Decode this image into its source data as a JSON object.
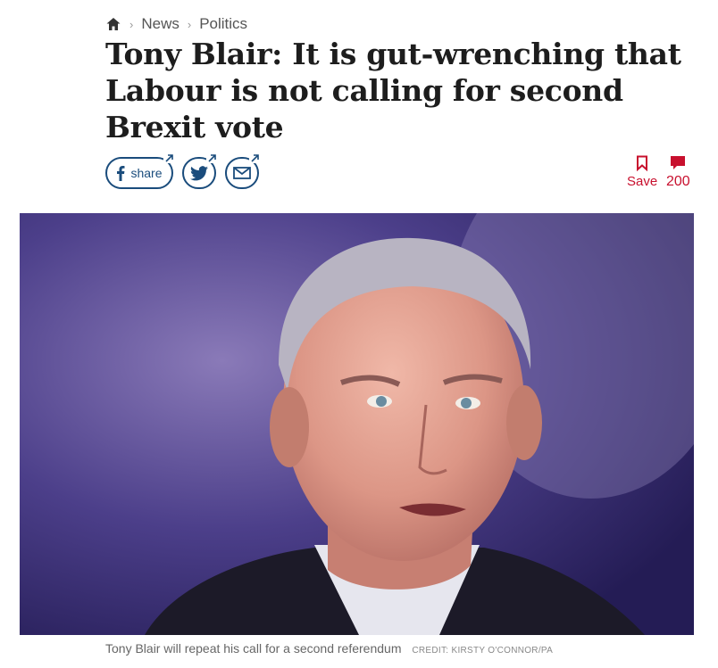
{
  "breadcrumb": {
    "items": [
      "News",
      "Politics"
    ]
  },
  "article": {
    "title": "Tony Blair: It is gut-wrenching that Labour is not calling for second Brexit vote"
  },
  "share": {
    "facebook_label": "share"
  },
  "actions": {
    "save_label": "Save",
    "comments_count": "200"
  },
  "image": {
    "caption": "Tony Blair will repeat his call for a second referendum",
    "credit_label": "CREDIT:",
    "credit": "KIRSTY O'CONNOR/PA"
  },
  "colors": {
    "brand_blue": "#1a4c7c",
    "accent_red": "#c8102e"
  }
}
